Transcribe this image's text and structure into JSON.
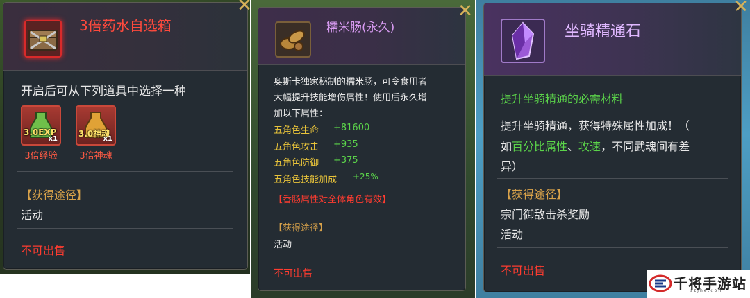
{
  "panel1": {
    "item_name": "3倍药水自选箱",
    "description": "开启后可从下列道具中选择一种",
    "rewards": [
      {
        "badge": "3.0EXP",
        "qty": "x1",
        "name": "3倍经验",
        "icon": "exp-potion-icon"
      },
      {
        "badge": "3.0神魂",
        "qty": "x1",
        "name": "3倍神魂",
        "icon": "soul-potion-icon"
      }
    ],
    "source_heading": "【获得途径】",
    "source_value": "活动",
    "sell_status": "不可出售",
    "icon": "chest-icon"
  },
  "panel2": {
    "item_name": "糯米肠(永久)",
    "description_lines": [
      "奥斯卡独家秘制的糯米肠，可令食用者",
      "大幅提升技能增伤属性！使用后永久增",
      "加以下属性："
    ],
    "attributes": [
      {
        "label": "五角色生命",
        "value": "+81600"
      },
      {
        "label": "五角色攻击",
        "value": "+935"
      },
      {
        "label": "五角色防御",
        "value": "+375"
      },
      {
        "label": "五角色技能加成",
        "value": "+25%"
      }
    ],
    "note": "【香肠属性对全体角色有效】",
    "source_heading": "【获得途径】",
    "source_value": "活动",
    "sell_status": "不可出售",
    "icon": "sausage-icon"
  },
  "panel3": {
    "item_name": "坐骑精通石",
    "subtitle": "提升坐骑精通的必需材料",
    "desc_line1": "提升坐骑精通，获得特殊属性加成！（",
    "desc_line2_pre": "如",
    "desc_line2_hl1": "百分比属性",
    "desc_line2_sep": "、",
    "desc_line2_hl2": "攻速",
    "desc_line2_post": "，不同武魂间有差",
    "desc_line3": "异）",
    "source_heading": "【获得途径】",
    "source_values": [
      "宗门御敌击杀奖励",
      "活动"
    ],
    "sell_status": "不可出售",
    "icon": "crystal-icon"
  },
  "watermark": {
    "text": "千将手游站",
    "url": "szjhe.com",
    "icon": "site-logo-icon"
  },
  "colors": {
    "red_text": "#ff3c30",
    "gold_text": "#e8c33a",
    "green_text": "#5bd44a",
    "purple_name": "#d89bf2"
  }
}
